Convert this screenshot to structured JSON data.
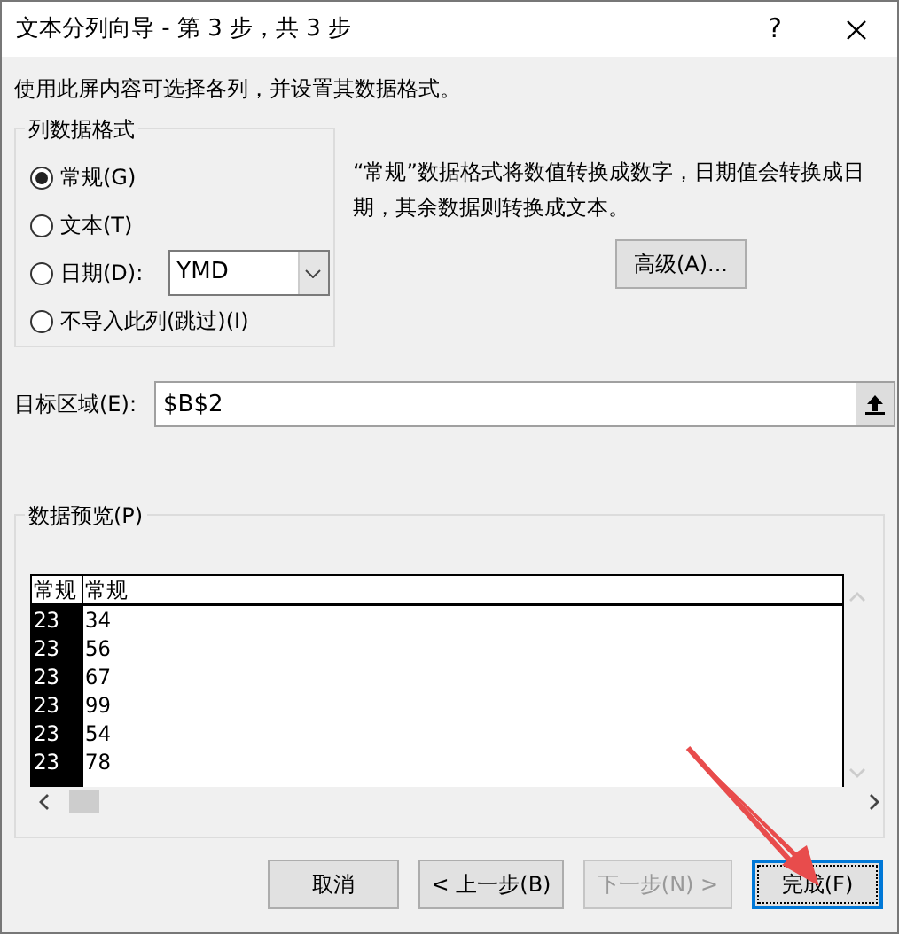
{
  "window": {
    "title": "文本分列向导 - 第 3 步，共 3 步",
    "help": "?"
  },
  "instruction": "使用此屏内容可选择各列，并设置其数据格式。",
  "column_format": {
    "title": "列数据格式",
    "options": [
      {
        "label": "常规(G)",
        "selected": true,
        "kind": "plain"
      },
      {
        "label": "文本(T)",
        "selected": false,
        "kind": "plain"
      },
      {
        "label": "日期(D):",
        "selected": false,
        "kind": "date"
      },
      {
        "label": "不导入此列(跳过)(I)",
        "selected": false,
        "kind": "plain"
      }
    ],
    "date_format": "YMD"
  },
  "description": "“常规”数据格式将数值转换成数字，日期值会转换成日期，其余数据则转换成文本。",
  "advanced_button": "高级(A)...",
  "destination": {
    "label": "目标区域(E):",
    "value": "$B$2"
  },
  "preview": {
    "title": "数据预览(P)",
    "columns": [
      {
        "header": "常规",
        "selected": true
      },
      {
        "header": "常规",
        "selected": false
      }
    ],
    "rows": [
      [
        "23",
        "34"
      ],
      [
        "23",
        "56"
      ],
      [
        "23",
        "67"
      ],
      [
        "23",
        "99"
      ],
      [
        "23",
        "54"
      ],
      [
        "23",
        "78"
      ]
    ]
  },
  "buttons": [
    {
      "label": "取消",
      "disabled": false,
      "focused": false
    },
    {
      "label": "< 上一步(B)",
      "disabled": false,
      "focused": false
    },
    {
      "label": "下一步(N) >",
      "disabled": true,
      "focused": false
    },
    {
      "label": "完成(F)",
      "disabled": false,
      "focused": true
    }
  ]
}
